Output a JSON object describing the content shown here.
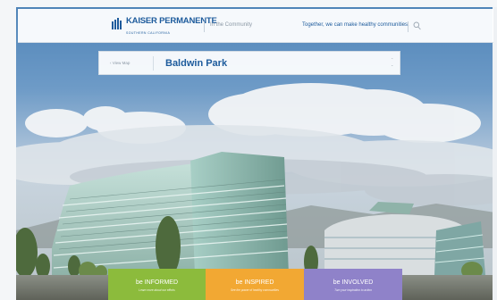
{
  "header": {
    "logo_text": "KAISER PERMANENTE",
    "logo_region": "SOUTHERN CALIFORNIA",
    "section": "In the Community",
    "tagline": "Together, we can make healthy communities.",
    "chevron": "⌄",
    "search_icon": "search-icon"
  },
  "location_bar": {
    "back_label": "‹  View Map",
    "location": "Baldwin Park",
    "arrows": [
      "⌃",
      "⌄"
    ]
  },
  "tiles": [
    {
      "title": "be INFORMED",
      "subtitle": "Learn more about our efforts",
      "color": "#8cbb3c"
    },
    {
      "title": "be INSPIRED",
      "subtitle": "See the power of healthy communities",
      "color": "#f2a833"
    },
    {
      "title": "be INVOLVED",
      "subtitle": "Turn your inspiration to action",
      "color": "#8f82c9"
    }
  ],
  "colors": {
    "brand_blue": "#1d5b9c",
    "sky": "#4f84b8"
  }
}
